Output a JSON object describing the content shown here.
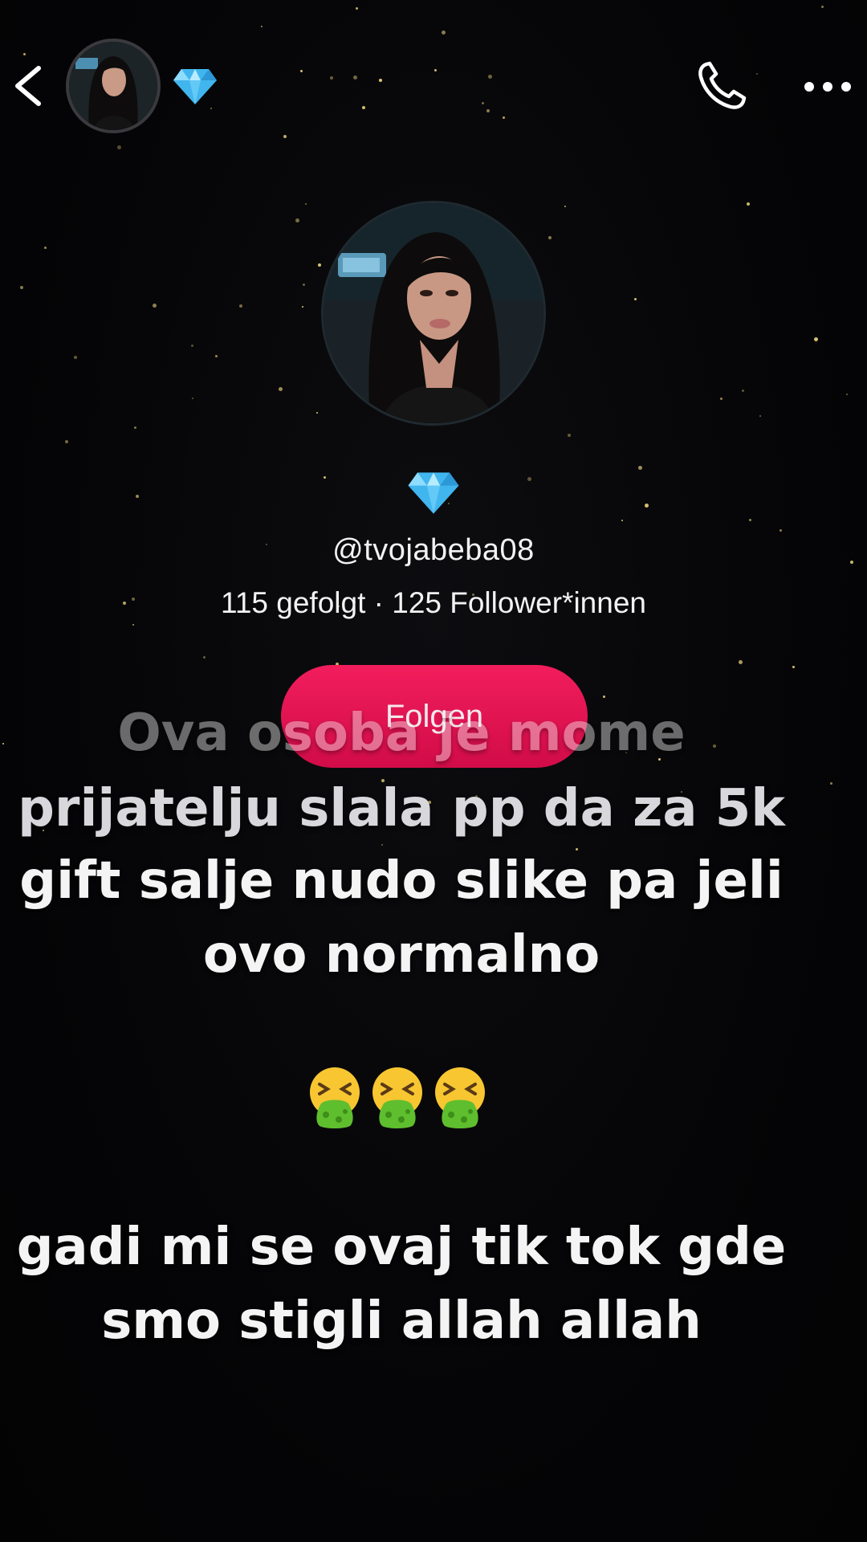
{
  "profile": {
    "username": "@tvojabeba08",
    "stats": "115 gefolgt · 125 Follower*innen",
    "follow_label": "Folgen"
  },
  "icons": {
    "back": "chevron-left-icon",
    "call": "phone-icon",
    "more": "more-horizontal-icon",
    "badge": "diamond-icon"
  },
  "caption": {
    "line1": "Ova osoba je mome",
    "line2": "prijatelju slala pp da za 5k",
    "line3": "gift salje nudo slike pa jeli",
    "line4": "ovo normalno",
    "emoji": "🤮🤮🤮",
    "line5": "gadi mi se ovaj tik tok gde",
    "line6": "smo stigli allah allah"
  },
  "colors": {
    "follow_button": "#e8155a",
    "background": "#050507",
    "diamond": "#3fb6f0"
  }
}
